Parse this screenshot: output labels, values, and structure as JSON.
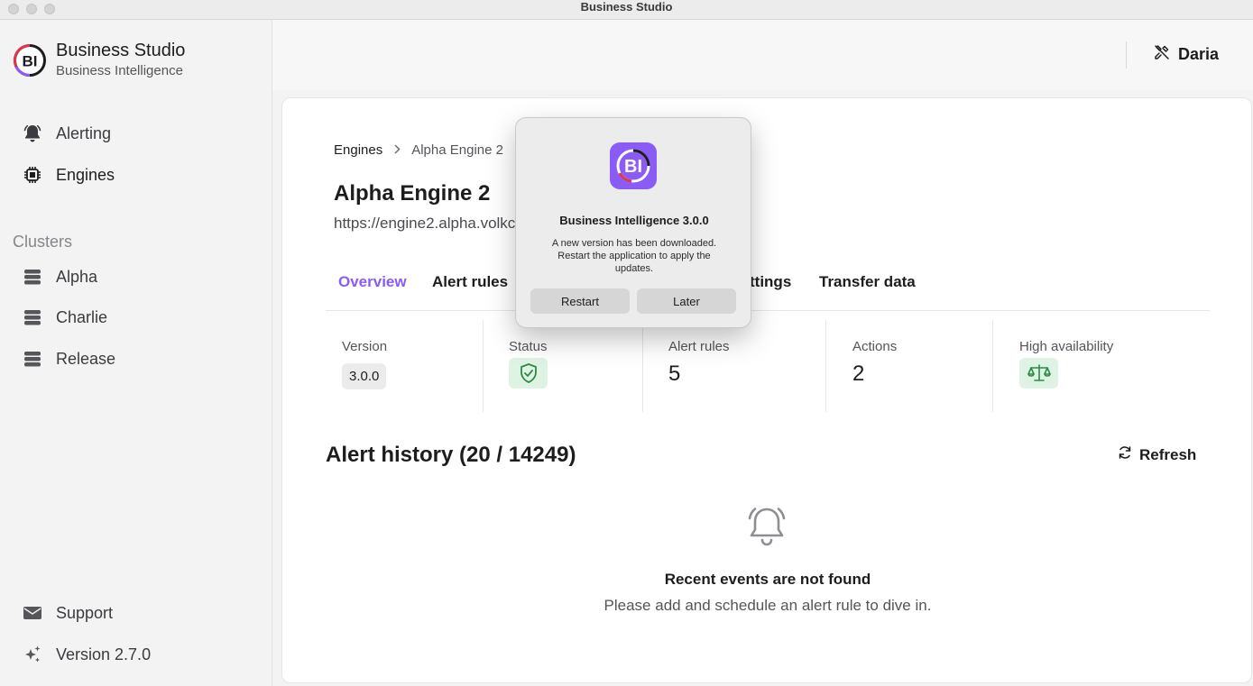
{
  "window": {
    "title": "Business Studio"
  },
  "sidebar": {
    "brand": {
      "name": "Business Studio",
      "subtitle": "Business Intelligence"
    },
    "nav": [
      {
        "label": "Alerting",
        "icon": "bell-icon"
      },
      {
        "label": "Engines",
        "icon": "chip-icon",
        "active": true
      }
    ],
    "clusters_label": "Clusters",
    "clusters": [
      {
        "label": "Alpha",
        "icon": "server-icon"
      },
      {
        "label": "Charlie",
        "icon": "server-icon"
      },
      {
        "label": "Release",
        "icon": "server-icon"
      }
    ],
    "footer": [
      {
        "label": "Support",
        "icon": "mail-icon"
      },
      {
        "label": "Version 2.7.0",
        "icon": "sparkles-icon"
      }
    ]
  },
  "header": {
    "user_name": "Daria",
    "user_icon": "tools-icon"
  },
  "main": {
    "breadcrumb": {
      "root": "Engines",
      "current": "Alpha Engine 2"
    },
    "title": "Alpha Engine 2",
    "url": "https://engine2.alpha.volkc",
    "tabs": [
      {
        "label": "Overview",
        "active": true
      },
      {
        "label": "Alert rules"
      },
      {
        "label": "ttings"
      },
      {
        "label": "Transfer data"
      }
    ],
    "stats": {
      "version": {
        "label": "Version",
        "value": "3.0.0"
      },
      "status": {
        "label": "Status",
        "icon": "shield-check-icon"
      },
      "alert_rules": {
        "label": "Alert rules",
        "value": "5"
      },
      "actions": {
        "label": "Actions",
        "value": "2"
      },
      "high_availability": {
        "label": "High availability",
        "icon": "scale-icon"
      }
    },
    "history": {
      "title": "Alert history (20 / 14249)",
      "refresh_label": "Refresh",
      "empty_title": "Recent events are not found",
      "empty_subtitle": "Please add and schedule an alert rule to dive in."
    }
  },
  "dialog": {
    "title": "Business Intelligence 3.0.0",
    "message": "A new version has been downloaded. Restart the application to apply the updates.",
    "primary_label": "Restart",
    "secondary_label": "Later"
  },
  "colors": {
    "accent": "#8a5cf5",
    "success_bg": "#dff3e4",
    "success": "#2f8a46"
  }
}
